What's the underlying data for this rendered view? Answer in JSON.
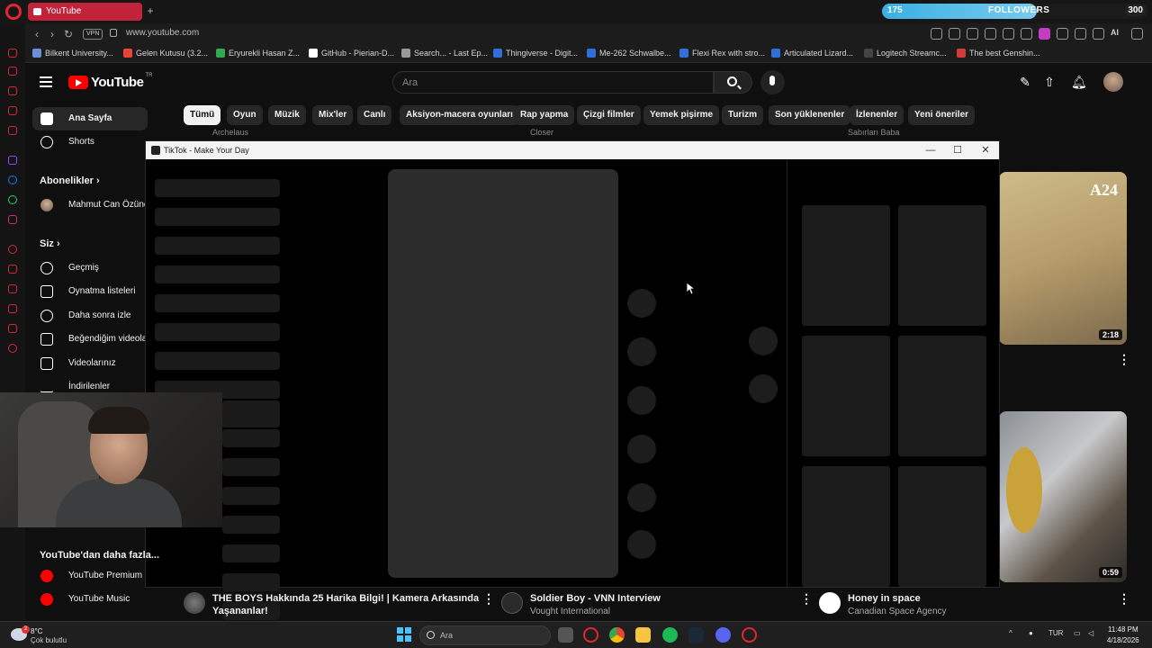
{
  "browser": {
    "tab_title": "YouTube",
    "url": "www.youtube.com",
    "vpn_label": "VPN",
    "new_tab_symbol": "+",
    "followers_widget": {
      "current": "175",
      "label": "FOLLOWERS",
      "goal": "300",
      "progress": 0.58
    },
    "ai_label": "AI"
  },
  "bookmarks": [
    {
      "label": "Bilkent University...",
      "color": "#6b8fd6"
    },
    {
      "label": "Gelen Kutusu (3.2...",
      "color": "#ea4335"
    },
    {
      "label": "Eryurekli Hasan Z...",
      "color": "#34a853"
    },
    {
      "label": "GitHub - Pierian-D...",
      "color": "#ffffff"
    },
    {
      "label": "Search... - Last Ep...",
      "color": "#999999"
    },
    {
      "label": "Thingiverse - Digit...",
      "color": "#2f6fd6"
    },
    {
      "label": "Me-262 Schwalbe...",
      "color": "#2f6fd6"
    },
    {
      "label": "Flexi Rex with stro...",
      "color": "#2f6fd6"
    },
    {
      "label": "Articulated Lizard...",
      "color": "#2f6fd6"
    },
    {
      "label": "Logitech Streamc...",
      "color": "#444444"
    },
    {
      "label": "The best Genshin...",
      "color": "#d33c3c"
    }
  ],
  "youtube": {
    "logo_text": "YouTube",
    "logo_region": "TR",
    "search_placeholder": "Ara",
    "chips": [
      "Tümü",
      "Oyun",
      "Müzik",
      "Mix'ler",
      "Canlı",
      "Aksiyon-macera oyunları",
      "Rap yapma",
      "Çizgi filmler",
      "Yemek pişirme",
      "Turizm",
      "Son yüklenenler",
      "İzlenenler",
      "Yeni öneriler"
    ],
    "nav": {
      "home": "Ana Sayfa",
      "shorts": "Shorts",
      "subscriptions_header": "Abonelikler",
      "subscription_channel": "Mahmut Can Özünel",
      "you_header": "Siz",
      "history": "Geçmiş",
      "playlists": "Oynatma listeleri",
      "watch_later": "Daha sonra izle",
      "liked": "Beğendiğim videolar",
      "your_videos": "Videolarınız",
      "downloads": "İndirilenler",
      "more_header": "YouTube'dan daha fazla...",
      "premium": "YouTube Premium",
      "music": "YouTube Music"
    },
    "behind_labels": [
      "Archelaus",
      "Closer",
      "Sabırları Baba"
    ],
    "right_thumbs": [
      {
        "brand": "A24",
        "duration": "2:18"
      },
      {
        "duration": "0:59"
      }
    ],
    "videos": [
      {
        "title_line1": "THE BOYS Hakkında 25 Harika Bilgi! | Kamera Arkasında",
        "title_line2": "Yaşananlar!",
        "channel": ""
      },
      {
        "title_line1": "Soldier Boy - VNN Interview",
        "title_line2": "",
        "channel": "Vought International"
      },
      {
        "title_line1": "Honey in space",
        "title_line2": "",
        "channel": "Canadian Space Agency"
      }
    ]
  },
  "popup": {
    "title": "TikTok - Make Your Day",
    "minimize": "—",
    "maximize": "☐",
    "close": "✕"
  },
  "taskbar": {
    "temp": "8°C",
    "weather": "Çok bulutlu",
    "weather_badge": "2",
    "search_placeholder": "Ara",
    "language": "TUR",
    "time": "11:48 PM",
    "date": "4/18/2026"
  }
}
